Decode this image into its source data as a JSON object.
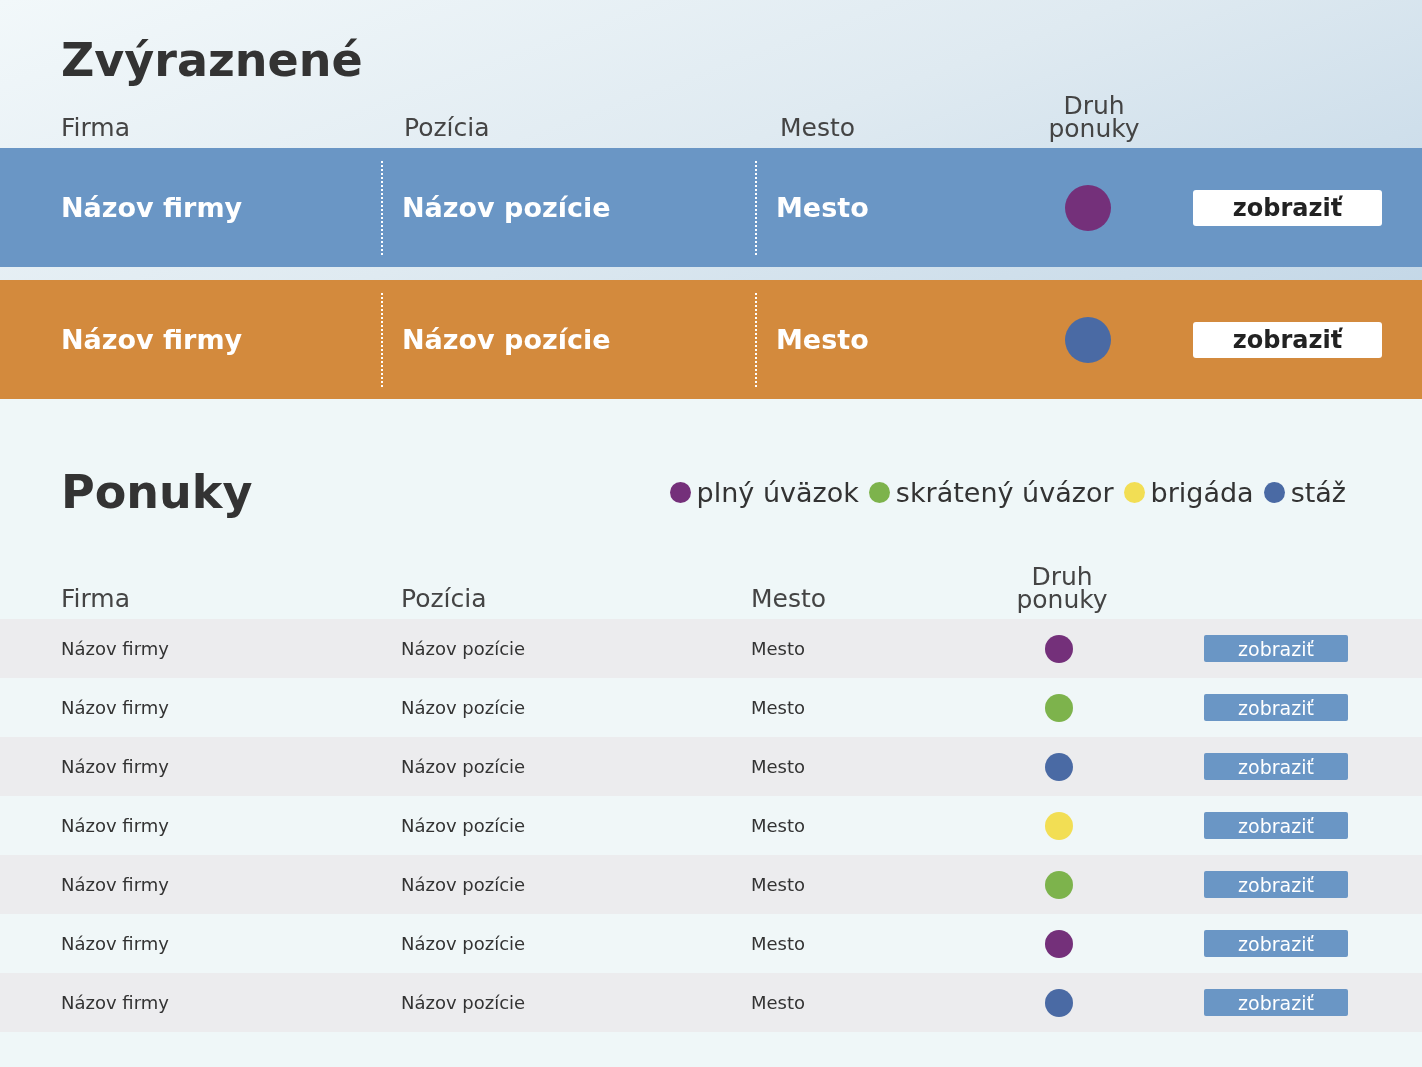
{
  "featured": {
    "title": "Zvýraznené",
    "columns": [
      "Firma",
      "Pozícia",
      "Mesto",
      "Druh ponuky"
    ],
    "rows": [
      {
        "company": "Názov firmy",
        "position": "Názov pozície",
        "city": "Mesto",
        "color": "#6a96c5",
        "dot": {
          "color": "#74307a"
        },
        "button": "zobraziť"
      },
      {
        "company": "Názov firmy",
        "position": "Názov pozície",
        "city": "Mesto",
        "color": "#d38a3d",
        "dot": {
          "color": "#4a6aa4"
        },
        "button": "zobraziť"
      }
    ]
  },
  "offers": {
    "title": "Ponuky",
    "legend": [
      {
        "label": "plný úväzok",
        "color": "#74307a"
      },
      {
        "label": "skrátený úvázor",
        "color": "#7db34c"
      },
      {
        "label": "brigáda",
        "color": "#f2de54"
      },
      {
        "label": "stáž",
        "color": "#4a6aa4"
      }
    ],
    "columns": [
      "Firma",
      "Pozícia",
      "Mesto",
      "Druh ponuky"
    ],
    "rows": [
      {
        "company": "Názov firmy",
        "position": "Názov pozície",
        "city": "Mesto",
        "color": "#74307a",
        "button": "zobraziť"
      },
      {
        "company": "Názov firmy",
        "position": "Názov pozície",
        "city": "Mesto",
        "color": "#7db34c",
        "button": "zobraziť"
      },
      {
        "company": "Názov firmy",
        "position": "Názov pozície",
        "city": "Mesto",
        "color": "#4a6aa4",
        "button": "zobraziť"
      },
      {
        "company": "Názov firmy",
        "position": "Názov pozície",
        "city": "Mesto",
        "color": "#f2de54",
        "button": "zobraziť"
      },
      {
        "company": "Názov firmy",
        "position": "Názov pozície",
        "city": "Mesto",
        "color": "#7db34c",
        "button": "zobraziť"
      },
      {
        "company": "Názov firmy",
        "position": "Názov pozície",
        "city": "Mesto",
        "color": "#74307a",
        "button": "zobraziť"
      },
      {
        "company": "Názov firmy",
        "position": "Názov pozície",
        "city": "Mesto",
        "color": "#4a6aa4",
        "button": "zobraziť"
      }
    ]
  }
}
